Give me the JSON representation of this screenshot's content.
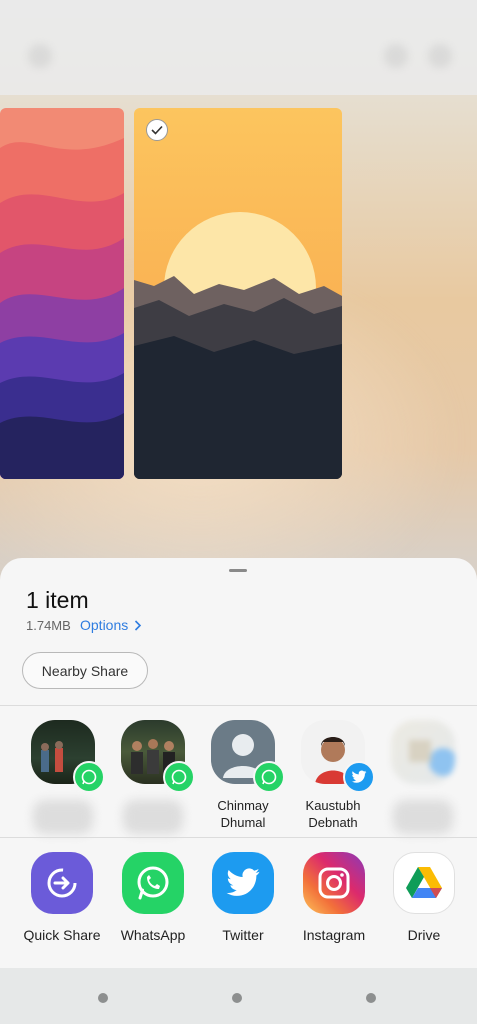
{
  "share_sheet": {
    "title": "1 item",
    "file_size": "1.74MB",
    "options_label": "Options",
    "nearby_share_label": "Nearby Share",
    "contacts": [
      {
        "name": "",
        "via": "whatsapp-icon"
      },
      {
        "name": "",
        "via": "whatsapp-icon"
      },
      {
        "name": "Chinmay\nDhumal",
        "via": "whatsapp-icon"
      },
      {
        "name": "Kaustubh\nDebnath",
        "via": "twitter-icon"
      },
      {
        "name": "",
        "via": ""
      }
    ],
    "apps": [
      {
        "label": "Quick Share",
        "icon": "quick-share-icon"
      },
      {
        "label": "WhatsApp",
        "icon": "whatsapp-icon"
      },
      {
        "label": "Twitter",
        "icon": "twitter-icon"
      },
      {
        "label": "Instagram",
        "icon": "instagram-icon"
      },
      {
        "label": "Drive",
        "icon": "google-drive-icon"
      }
    ]
  },
  "colors": {
    "accent_link": "#2f7de0",
    "whatsapp_green": "#25d366",
    "twitter_blue": "#1d9bf0",
    "quick_share_purple": "#6b5bd9"
  }
}
